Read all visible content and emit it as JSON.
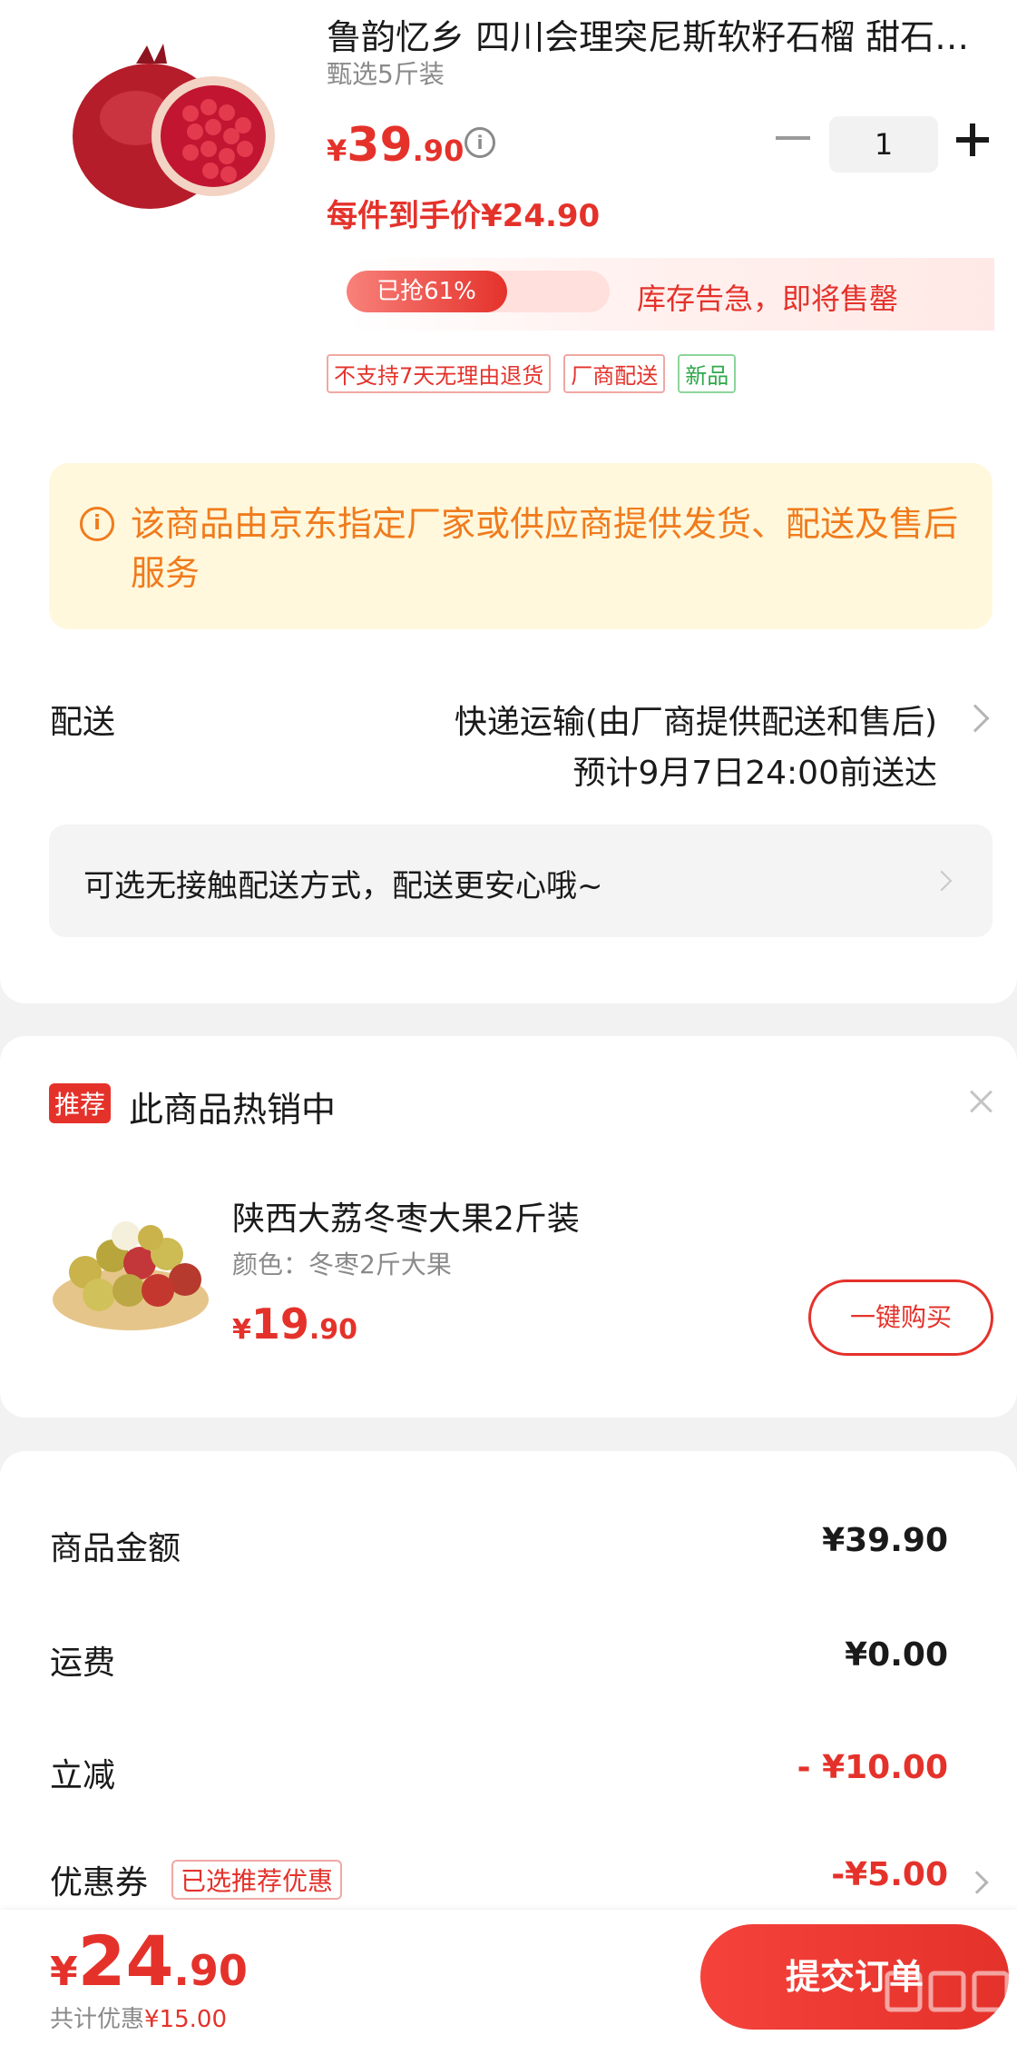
{
  "product": {
    "title": "鲁韵忆乡 四川会理突尼斯软籽石榴 甜石…",
    "spec": "甄选5斤装",
    "price_symbol": "¥",
    "price_int": "39",
    "price_dec": ".90",
    "final_price": "每件到手价¥24.90",
    "quantity": "1",
    "stock_percent_label": "已抢61%",
    "stock_percent": 61,
    "stock_warning": "库存告急，即将售罄",
    "tags": [
      "不支持7天无理由退货",
      "厂商配送",
      "新品"
    ]
  },
  "notice": {
    "text": "该商品由京东指定厂家或供应商提供发货、配送及售后服务"
  },
  "shipping": {
    "label": "配送",
    "method": "快递运输(由厂商提供配送和售后)",
    "eta": "预计9月7日24:00前送达",
    "contactless": "可选无接触配送方式，配送更安心哦~"
  },
  "recommend": {
    "badge": "推荐",
    "title": "此商品热销中",
    "item_name": "陕西大荔冬枣大果2斤装",
    "item_spec": "颜色：冬枣2斤大果",
    "price_symbol": "¥",
    "price_int": "19",
    "price_dec": ".90",
    "buy_label": "一键购买"
  },
  "summary": {
    "goods_label": "商品金额",
    "goods_value": "¥39.90",
    "freight_label": "运费",
    "freight_value": "¥0.00",
    "discount_label": "立减",
    "discount_value": "- ¥10.00",
    "coupon_label": "优惠券",
    "coupon_tag": "已选推荐优惠",
    "coupon_value": "-¥5.00"
  },
  "bottom": {
    "total_symbol": "¥",
    "total_int": "24",
    "total_dec": ".90",
    "saved_label": "共计优惠",
    "saved_amount": "¥15.00",
    "submit_label": "提交订单"
  },
  "colors": {
    "accent": "#e4322b",
    "notice_bg": "#fff8dc",
    "notice_text": "#f07b1d",
    "new_tag": "#2fa84a"
  }
}
